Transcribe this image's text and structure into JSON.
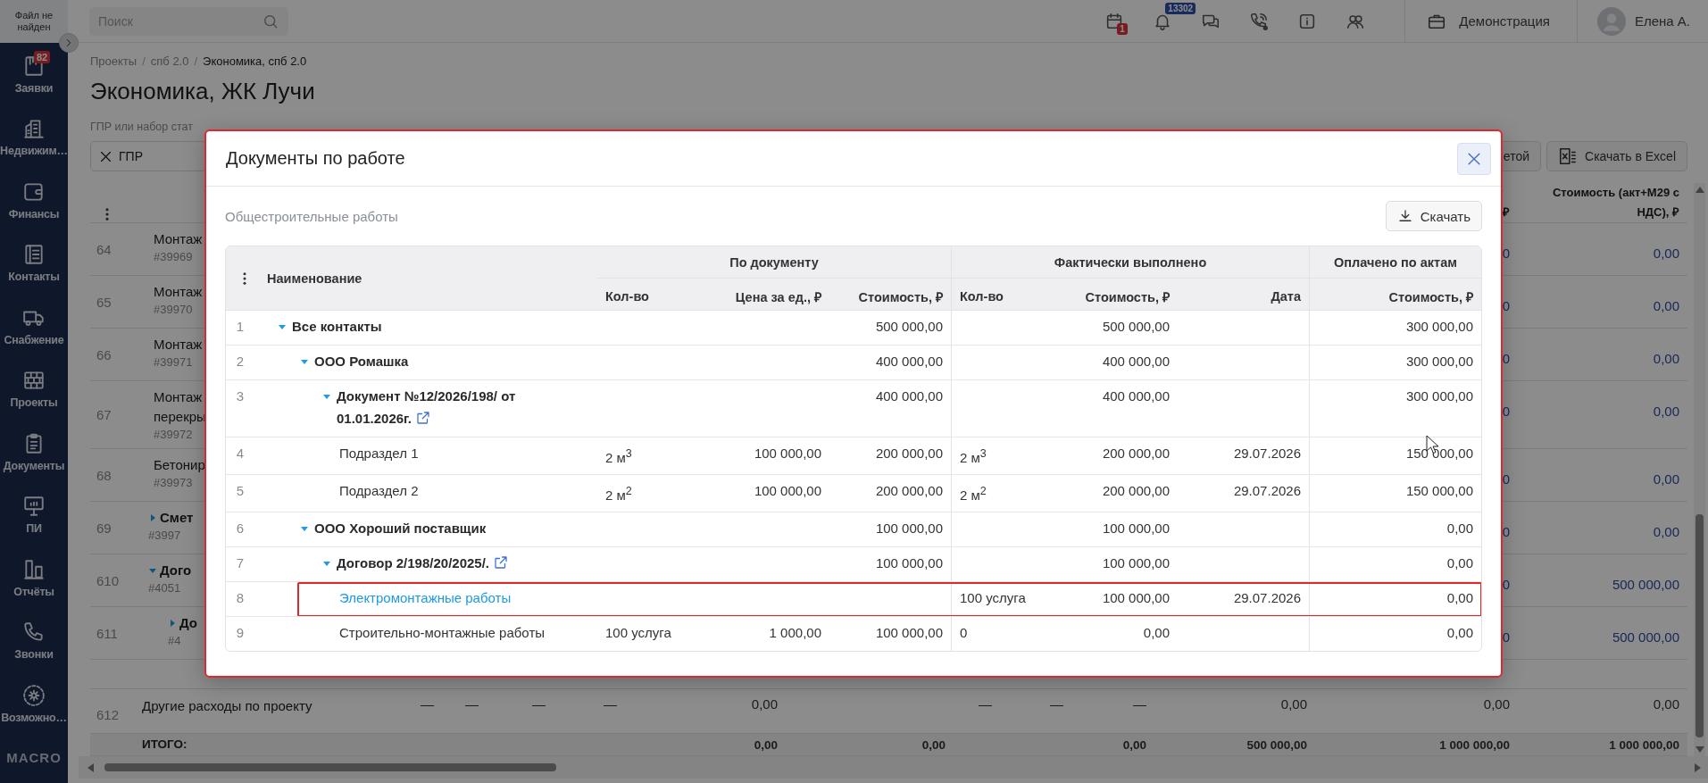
{
  "sidebar": {
    "logo": "Файл не найден",
    "items": [
      {
        "label": "Заявки",
        "badge": "82"
      },
      {
        "label": "Недвижим…"
      },
      {
        "label": "Финансы"
      },
      {
        "label": "Контакты"
      },
      {
        "label": "Снабжение"
      },
      {
        "label": "Проекты"
      },
      {
        "label": "Документы"
      },
      {
        "label": "ПИ"
      },
      {
        "label": "Отчёты"
      },
      {
        "label": "Звонки"
      },
      {
        "label": "Возможно…"
      }
    ],
    "brand": "MACRO"
  },
  "topbar": {
    "search": {
      "placeholder": "Поиск"
    },
    "calendar": {
      "badge": "1"
    },
    "notifications": {
      "badge": "13302"
    },
    "company": "Демонстрация",
    "user": {
      "name": "Елена А."
    }
  },
  "page": {
    "breadcrumbs": [
      {
        "label": "Проекты"
      },
      {
        "separator": "/",
        "label": "спб 2.0"
      },
      {
        "separator": "/",
        "label": "Экономика, спб 2.0"
      }
    ],
    "title": "Экономика, ЖК Лучи",
    "filter": {
      "label": "ГПР или набор стат",
      "chip": "ГПР"
    },
    "buttons": [
      "етой",
      "Скачать в Excel"
    ],
    "table": {
      "headers": {
        "column_13": "₽",
        "column_14": "Стоимость (акт+М29 с НДС), ₽"
      },
      "rows": [
        {
          "number": "64",
          "name": "Монтаж",
          "code": "#39969",
          "column_13": "0",
          "column_14": "0,00"
        },
        {
          "number": "65",
          "name": "Монтаж",
          "code": "#39970",
          "column_13": "0",
          "column_14": "0,00"
        },
        {
          "number": "66",
          "name": "Монтаж",
          "code": "#39971",
          "column_13": "0",
          "column_14": "0,00"
        },
        {
          "number": "67",
          "name": "Монтаж перекры",
          "code": "#39972",
          "column_13": "0",
          "column_14": "0,00"
        },
        {
          "number": "68",
          "name": "Бетонир",
          "code": "#39973",
          "column_13": "0",
          "column_14": "0,00"
        },
        {
          "number": "69",
          "name": "Смет",
          "code": "#3997",
          "expanded": false,
          "column_13": "0",
          "column_14": "0,00"
        },
        {
          "number": "610",
          "name": "Дого",
          "code": "#4051",
          "expanded": true,
          "column_13": "0",
          "column_14": "500 000,00",
          "children": [
            {
              "number": "611",
              "name": "До",
              "code": "#4",
              "expanded": false,
              "column_13": "0",
              "column_14": "500 000,00"
            }
          ]
        }
      ],
      "other_row": {
        "number": "612",
        "name": "Другие расходы по проекту",
        "column_3": "—",
        "column_4": "—",
        "column_5": "—",
        "column_6": "—",
        "column_7": "0,00",
        "column_9": "—",
        "column_10": "—",
        "column_11": "—",
        "column_12": "0,00",
        "column_13": "0,00",
        "column_14": "0,00"
      },
      "total_row": {
        "name": "ИТОГО:",
        "column_7": "0,00",
        "column_8": "0,00",
        "column_11": "0,00",
        "column_12": "500 000,00",
        "column_13": "1 000 000,00",
        "column_14": "1 000 000,00"
      }
    }
  },
  "dialog": {
    "title": "Документы по работе",
    "highlighted": true,
    "subtitle": "Общестроительные работы",
    "download_button": "Скачать",
    "table": {
      "name_header": "Наименование",
      "groups": [
        {
          "label": "По документу",
          "columns": [
            "Кол-во",
            "Цена за ед., ₽",
            "Стоимость, ₽"
          ]
        },
        {
          "label": "Фактически выполнено",
          "columns": [
            "Кол-во",
            "Стоимость, ₽",
            "Дата"
          ]
        },
        {
          "label": "Оплачено по актам",
          "columns": [
            "Стоимость, ₽"
          ]
        }
      ],
      "rows": [
        {
          "number": "1",
          "name": "Все контакты",
          "kind": "group",
          "expanded": true,
          "highlighted": false,
          "values": {
            "doc_cost": "500 000,00",
            "fact_cost": "500 000,00",
            "paid_cost": "300 000,00"
          },
          "children": [
            {
              "number": "2",
              "name": "ООО Ромашка",
              "kind": "group",
              "expanded": true,
              "highlighted": false,
              "values": {
                "doc_cost": "400 000,00",
                "fact_cost": "400 000,00",
                "paid_cost": "300 000,00"
              },
              "children": [
                {
                  "number": "3",
                  "name": "Документ №12/2026/198/ от 01.01.2026г.",
                  "kind": "document",
                  "expanded": true,
                  "highlighted": false,
                  "values": {
                    "doc_cost": "400 000,00",
                    "fact_cost": "400 000,00",
                    "paid_cost": "300 000,00"
                  },
                  "children": [
                    {
                      "number": "4",
                      "name": "Подраздел 1",
                      "kind": "item",
                      "highlighted": false,
                      "values": {
                        "doc_qty": "2 м$^{3}$",
                        "doc_price": "100 000,00",
                        "doc_cost": "200 000,00",
                        "fact_qty": "2 м$^{3}$",
                        "fact_cost": "200 000,00",
                        "fact_date": "29.07.2026",
                        "paid_cost": "150 000,00"
                      }
                    },
                    {
                      "number": "5",
                      "name": "Подраздел 2",
                      "kind": "item",
                      "highlighted": false,
                      "values": {
                        "doc_qty": "2 м$^{2}$",
                        "doc_price": "100 000,00",
                        "doc_cost": "200 000,00",
                        "fact_qty": "2 м$^{2}$",
                        "fact_cost": "200 000,00",
                        "fact_date": "29.07.2026",
                        "paid_cost": "150 000,00"
                      }
                    }
                  ]
                }
              ]
            },
            {
              "number": "6",
              "name": "ООО Хороший поставщик",
              "kind": "group",
              "expanded": true,
              "highlighted": false,
              "values": {
                "doc_cost": "100 000,00",
                "fact_cost": "100 000,00",
                "paid_cost": "0,00"
              },
              "children": [
                {
                  "number": "7",
                  "name": "Договор 2/198/20/2025/.",
                  "kind": "document",
                  "expanded": true,
                  "highlighted": false,
                  "values": {
                    "doc_cost": "100 000,00",
                    "fact_cost": "100 000,00",
                    "paid_cost": "0,00"
                  },
                  "children": [
                    {
                      "number": "8",
                      "name": "Электромонтажные работы",
                      "kind": "item",
                      "highlighted": true,
                      "values": {
                        "fact_qty": "100 услуга",
                        "fact_cost": "100 000,00",
                        "fact_date": "29.07.2026",
                        "paid_cost": "0,00"
                      }
                    },
                    {
                      "number": "9",
                      "name": "Строительно-монтажные работы",
                      "kind": "item",
                      "highlighted": false,
                      "values": {
                        "doc_qty": "100 услуга",
                        "doc_price": "1 000,00",
                        "doc_cost": "100 000,00",
                        "fact_qty": "0",
                        "fact_cost": "0,00",
                        "paid_cost": "0,00"
                      }
                    }
                  ]
                }
              ]
            }
          ]
        }
      ]
    }
  }
}
